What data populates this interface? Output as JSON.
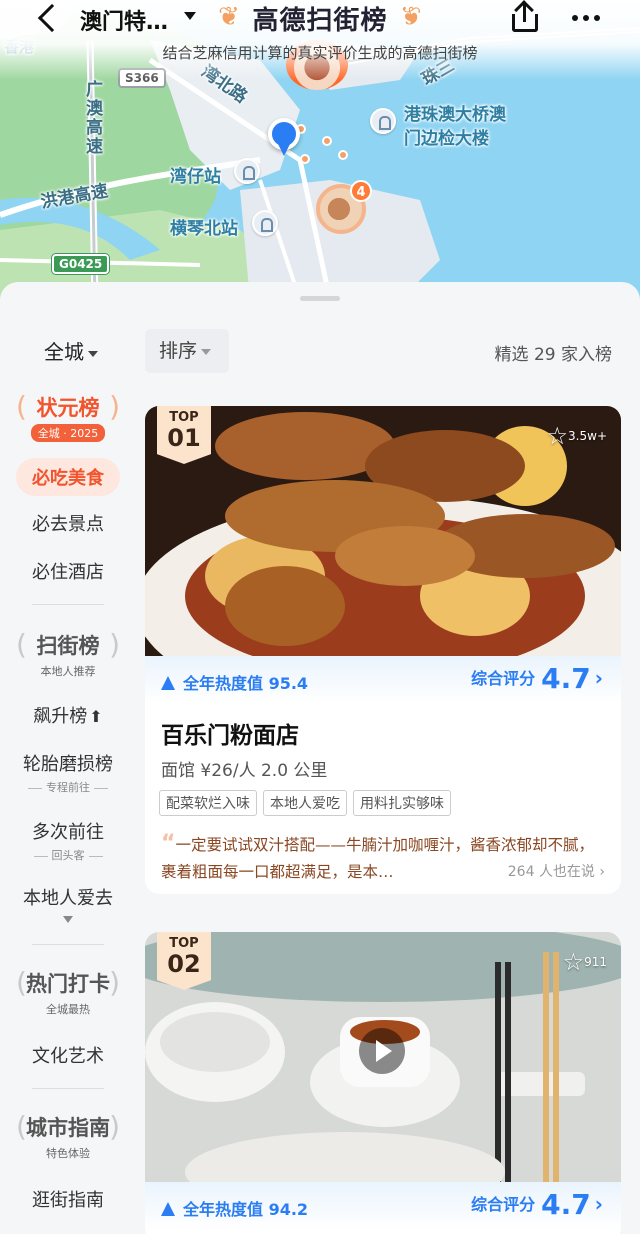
{
  "header": {
    "city": "澳门特…",
    "brand": "高德扫街榜",
    "subtitle": "结合芝麻信用计算的真实评价生成的高德扫街榜"
  },
  "map": {
    "labels": {
      "hongkong": "香港",
      "guangao_highway": "广澳高速",
      "zhuhai_bei_road": "湾北路",
      "zhusan": "珠三",
      "bridge_port": "港珠澳大桥澳",
      "bridge_port2": "门边检大楼",
      "wanzai": "湾仔站",
      "hengqin": "横琴北站",
      "honggang": "洪港高速"
    },
    "roads": {
      "s366": "S366",
      "g0425": "G0425"
    },
    "food_marker_count": "4"
  },
  "panel": {
    "city_filter": "全城",
    "sort_label": "排序",
    "count_text": "精选 29 家入榜"
  },
  "sidebar": {
    "badge1": {
      "title": "状元榜",
      "sub": "全城 · 2025"
    },
    "cat_food": "必吃美食",
    "cat_sights": "必去景点",
    "cat_hotel": "必住酒店",
    "badge2": {
      "title": "扫街榜",
      "sub": "本地人推荐"
    },
    "rising": "飙升榜",
    "tire": "轮胎磨损榜",
    "tire_sub": "专程前往",
    "repeat": "多次前往",
    "repeat_sub": "回头客",
    "locals": "本地人爱去",
    "badge3": {
      "title": "热门打卡",
      "sub": "全城最热"
    },
    "culture": "文化艺术",
    "badge4": {
      "title": "城市指南",
      "sub": "特色体验"
    },
    "street": "逛街指南"
  },
  "cards": [
    {
      "top_label": "TOP",
      "rank": "01",
      "favorites": "3.5w+",
      "heat": "全年热度值 95.4",
      "score_label": "综合评分",
      "score": "4.7",
      "name": "百乐门粉面店",
      "meta": "面馆 ¥26/人 2.0 公里",
      "tags": [
        "配菜软烂入味",
        "本地人爱吃",
        "用料扎实够味"
      ],
      "review": "一定要试试双汁搭配——牛腩汁加咖喱汁，酱香浓郁却不腻，裹着粗面每一口都超满足，是本…",
      "review_count": "264 人也在说 ›"
    },
    {
      "top_label": "TOP",
      "rank": "02",
      "favorites": "911",
      "heat": "全年热度值 94.2",
      "score_label": "综合评分",
      "score": "4.7"
    }
  ],
  "colors": {
    "accent_blue": "#2a7df3",
    "accent_orange": "#f2542d"
  }
}
